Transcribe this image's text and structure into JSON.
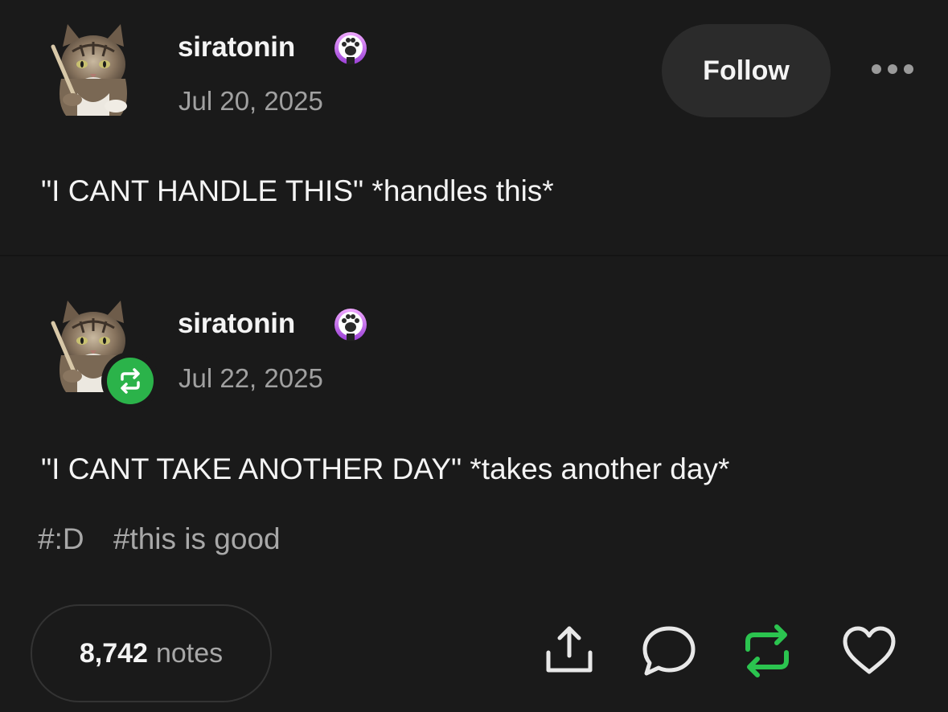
{
  "original_post": {
    "username": "siratonin",
    "date": "Jul 20, 2025",
    "follow_label": "Follow",
    "body": "\"I CANT HANDLE THIS\" *handles this*"
  },
  "reblog_post": {
    "username": "siratonin",
    "date": "Jul 22, 2025",
    "body": "\"I CANT TAKE ANOTHER DAY\" *takes another day*",
    "tags": [
      "#:D",
      "#this is good"
    ]
  },
  "footer": {
    "notes_count": "8,742",
    "notes_label": "notes",
    "actions": [
      "share-icon",
      "reply-icon",
      "reblog-icon",
      "heart-icon"
    ]
  },
  "colors": {
    "background": "#1a1a1a",
    "reblog_green": "#2bb34a",
    "badge_purple": "#c06ae8",
    "muted_text": "#a0a0a0"
  }
}
